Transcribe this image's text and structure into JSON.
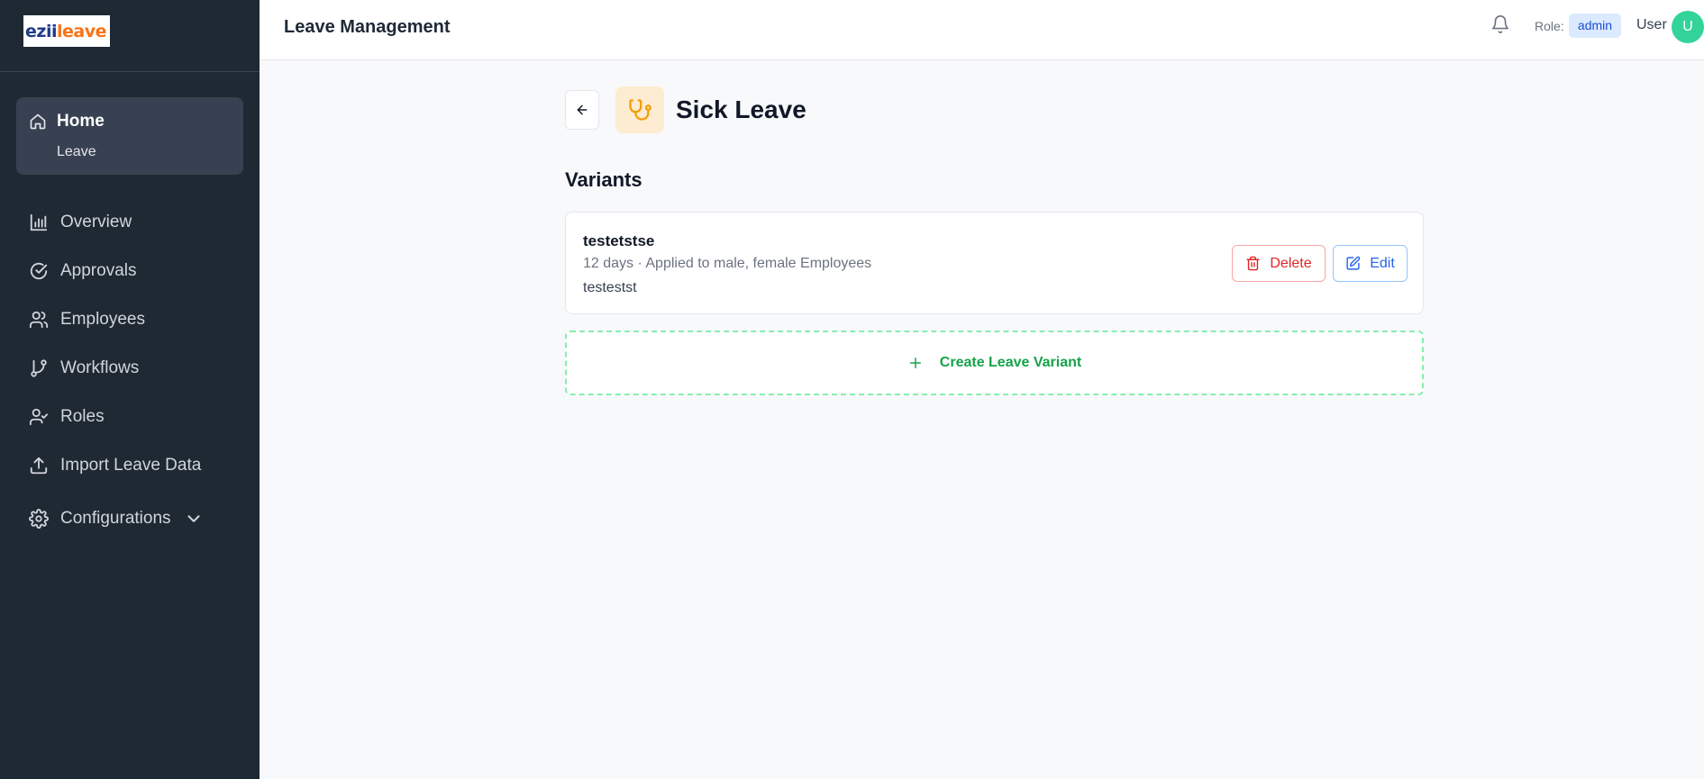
{
  "app": {
    "logo_part1": "ezii",
    "logo_part2": "leave",
    "header_title": "Leave Management"
  },
  "sidebar": {
    "home_label": "Home",
    "home_sub_label": "Leave",
    "items": [
      {
        "label": "Overview",
        "icon": "bar-chart-icon"
      },
      {
        "label": "Approvals",
        "icon": "check-circle-icon"
      },
      {
        "label": "Employees",
        "icon": "users-icon"
      },
      {
        "label": "Workflows",
        "icon": "git-branch-icon"
      },
      {
        "label": "Roles",
        "icon": "user-check-icon"
      },
      {
        "label": "Import Leave Data",
        "icon": "upload-icon"
      },
      {
        "label": "Configurations",
        "icon": "gear-icon"
      }
    ]
  },
  "header": {
    "role_label": "Role:",
    "role_value": "admin",
    "user_label": "User",
    "avatar_initial": "U"
  },
  "page": {
    "title": "Sick Leave",
    "type_icon": "stethoscope-icon",
    "section_title": "Variants"
  },
  "variants": [
    {
      "name": "testetstse",
      "meta": "12 days · Applied to male, female Employees",
      "description": "testestst",
      "delete_label": "Delete",
      "edit_label": "Edit"
    }
  ],
  "create_label": "Create Leave Variant",
  "colors": {
    "sidebar_bg": "#1f2933",
    "active_item_bg": "#374151",
    "accent_green": "#16a34a",
    "delete_red": "#dc2626",
    "edit_blue": "#2563eb",
    "avatar_green": "#34d399"
  }
}
